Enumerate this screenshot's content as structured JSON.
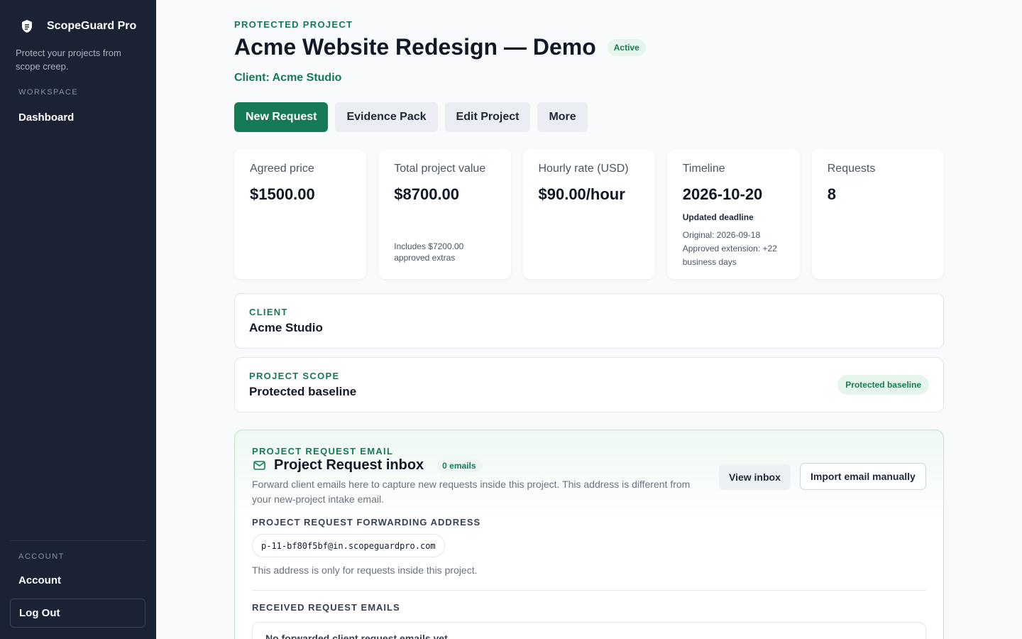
{
  "sidebar": {
    "brand": "ScopeGuard Pro",
    "tagline": "Protect your projects from scope creep.",
    "workspace_label": "WORKSPACE",
    "dashboard": "Dashboard",
    "account_label": "ACCOUNT",
    "account": "Account",
    "logout": "Log Out"
  },
  "header": {
    "eyebrow": "PROTECTED PROJECT",
    "title": "Acme Website Redesign — Demo",
    "status": "Active",
    "client": "Client: Acme Studio"
  },
  "actions": {
    "new_request": "New Request",
    "evidence_pack": "Evidence Pack",
    "edit_project": "Edit Project",
    "more": "More"
  },
  "stats": {
    "agreed_price": {
      "label": "Agreed price",
      "value": "$1500.00"
    },
    "total_value": {
      "label": "Total project value",
      "value": "$8700.00",
      "note": "Includes $7200.00 approved extras"
    },
    "hourly_rate": {
      "label": "Hourly rate (USD)",
      "value": "$90.00/hour"
    },
    "timeline": {
      "label": "Timeline",
      "value": "2026-10-20",
      "sub": "Updated deadline",
      "original": "Original: 2026-09-18",
      "extension": "Approved extension: +22 business days"
    },
    "requests": {
      "label": "Requests",
      "value": "8"
    }
  },
  "client_card": {
    "eyebrow": "CLIENT",
    "name": "Acme Studio"
  },
  "scope_card": {
    "eyebrow": "PROJECT SCOPE",
    "title": "Protected baseline",
    "badge": "Protected baseline"
  },
  "email_card": {
    "eyebrow": "PROJECT REQUEST EMAIL",
    "title": "Project Request inbox",
    "count": "0 emails",
    "description": "Forward client emails here to capture new requests inside this project. This address is different from your new-project intake email.",
    "forwarding_label": "PROJECT REQUEST FORWARDING ADDRESS",
    "address": "p-11-bf80f5bf@in.scopeguardpro.com",
    "help": "This address is only for requests inside this project.",
    "received_label": "RECEIVED REQUEST EMAILS",
    "empty": "No forwarded client request emails yet.",
    "view_inbox": "View inbox",
    "import_manual": "Import email manually"
  },
  "colors": {
    "accent": "#157a55",
    "sidebar": "#1a2233"
  },
  "icons": {
    "brand": "shield-icon",
    "inbox": "mail-icon"
  }
}
